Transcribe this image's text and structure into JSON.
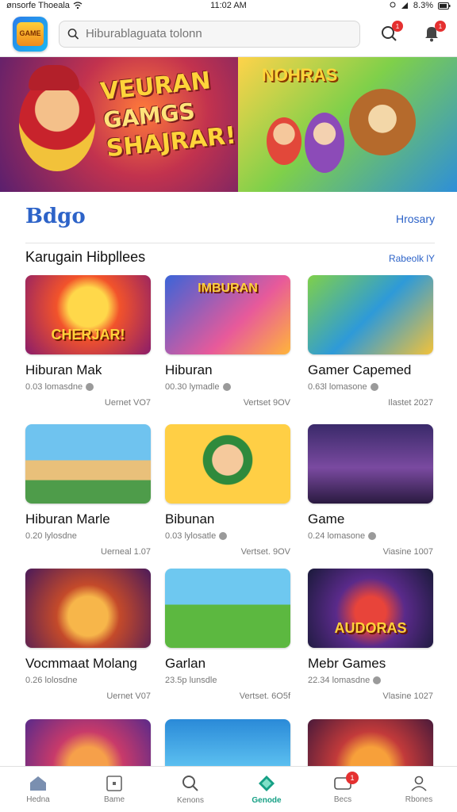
{
  "status_bar": {
    "carrier": "ønsorfe Thoeala",
    "time": "11:02 AM",
    "battery": "8.3%"
  },
  "header": {
    "logo_text": "GAME",
    "search_placeholder": "Hiburablaguata tolonn",
    "notification_badge": "1",
    "alert_badge": "1"
  },
  "hero": {
    "left_title_line1": "VEURAN",
    "left_title_line2": "GAMGS",
    "left_title_line3": "SHAJRAR!",
    "right_title": "NOHRAS"
  },
  "section_primary": {
    "title": "Bdgo",
    "link": "Hrosary"
  },
  "section_games": {
    "title": "Karugain Hibpllees",
    "link": "Rabeolk lY"
  },
  "games": [
    {
      "name": "Hiburan Mak",
      "meta": "0.03 lomasdne",
      "version": "Uernet VO7",
      "thumb_text": "CHERJAR!"
    },
    {
      "name": "Hiburan",
      "meta": "00.30 lymadle",
      "version": "Vertset 9OV",
      "thumb_text": "IMBURAN"
    },
    {
      "name": "Gamer Capemed",
      "meta": "0.63l lomasone",
      "version": "Ilastet 2027",
      "thumb_text": ""
    },
    {
      "name": "Hiburan Marle",
      "meta": "0.20 lylosdne",
      "version": "Uerneal 1.07",
      "thumb_text": ""
    },
    {
      "name": "Bibunan",
      "meta": "0.03 lylosatle",
      "version": "Vertset. 9OV",
      "thumb_text": ""
    },
    {
      "name": "Game",
      "meta": "0.24 lomasone",
      "version": "Viasine 1007",
      "thumb_text": ""
    },
    {
      "name": "Vocmmaat Molang",
      "meta": "0.26 lolosdne",
      "version": "Uernet V07",
      "thumb_text": ""
    },
    {
      "name": "Garlan",
      "meta": "23.5p lunsdle",
      "version": "Vertset. 6O5f",
      "thumb_text": ""
    },
    {
      "name": "Mebr Games",
      "meta": "22.34 lomasdne",
      "version": "Vlasine 1027",
      "thumb_text": "AUDORAS"
    },
    {
      "name": "",
      "meta": "",
      "version": "",
      "thumb_text": ""
    },
    {
      "name": "",
      "meta": "",
      "version": "",
      "thumb_text": ""
    },
    {
      "name": "",
      "meta": "",
      "version": "",
      "thumb_text": ""
    }
  ],
  "bottom_nav": [
    {
      "label": "Hedna",
      "icon": "home-icon"
    },
    {
      "label": "Bame",
      "icon": "square-icon"
    },
    {
      "label": "Kenons",
      "icon": "search-icon"
    },
    {
      "label": "Genode",
      "icon": "diamond-icon",
      "active": true
    },
    {
      "label": "Becs",
      "icon": "gamepad-icon",
      "badge": "1"
    },
    {
      "label": "Rbones",
      "icon": "user-icon"
    }
  ],
  "colors": {
    "accent": "#2d63c8",
    "active_nav": "#16a085",
    "badge": "#e53030"
  }
}
